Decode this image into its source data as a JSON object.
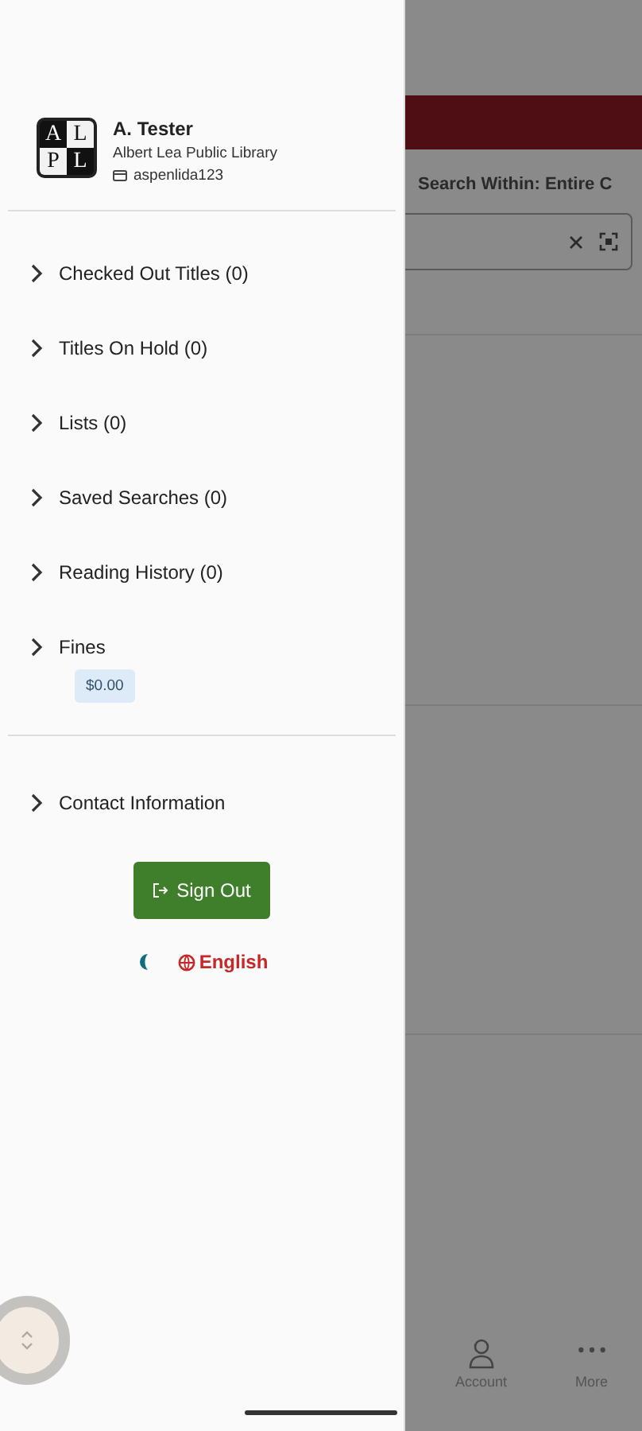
{
  "drawer": {
    "logo_letters": [
      "A",
      "L",
      "P",
      "L"
    ],
    "user_name": "A. Tester",
    "library": "Albert Lea Public Library",
    "username": "aspenlida123",
    "items": [
      {
        "label": "Checked Out Titles (0)",
        "expanded": false
      },
      {
        "label": "Titles On Hold (0)",
        "expanded": false
      },
      {
        "label": "Lists (0)",
        "expanded": false
      },
      {
        "label": "Saved Searches (0)",
        "expanded": false
      },
      {
        "label": "Reading History (0)",
        "expanded": false
      },
      {
        "label": "Fines",
        "expanded": false,
        "badge": "$0.00"
      }
    ],
    "contact_item": {
      "label": "Contact Information",
      "expanded": false
    },
    "sign_out": "Sign Out",
    "language": "English"
  },
  "background": {
    "search_within": "Search Within: Entire C",
    "tabs": [
      {
        "label": "Account",
        "selected": false
      },
      {
        "label": "More",
        "selected": false
      }
    ]
  }
}
